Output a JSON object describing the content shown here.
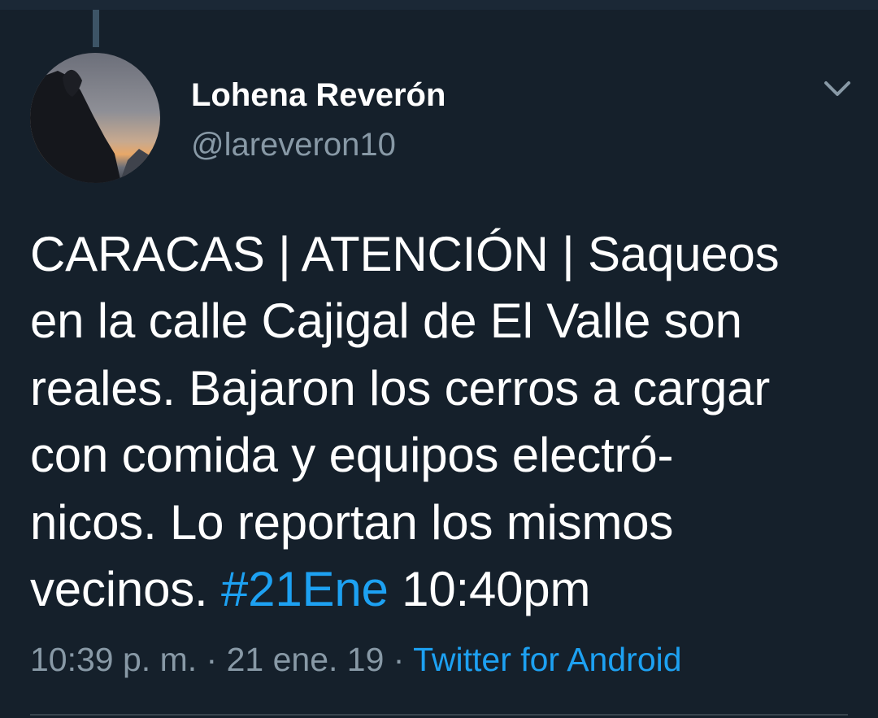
{
  "tweet": {
    "author": {
      "name": "Lohena Reverón",
      "handle": "@lareveron10"
    },
    "text_lines": [
      "CARACAS | ATENCIÓN | Saqueos",
      "en la calle Cajigal de El Valle son",
      "reales. Bajaron los cerros a cargar",
      "con comida y equipos electró-",
      "nicos. Lo reportan los mismos"
    ],
    "last_line": {
      "prefix": "vecinos.",
      "hashtag": "#21Ene",
      "suffix": "10:40pm"
    },
    "meta": {
      "time": "10:39 p. m.",
      "separator": "·",
      "date": "21 ene. 19",
      "source": "Twitter for Android"
    }
  },
  "icons": {
    "menu": "chevron-down-icon"
  },
  "colors": {
    "background": "#15202b",
    "primary_text": "#ffffff",
    "secondary_text": "#8899a6",
    "accent": "#1da1f2"
  }
}
